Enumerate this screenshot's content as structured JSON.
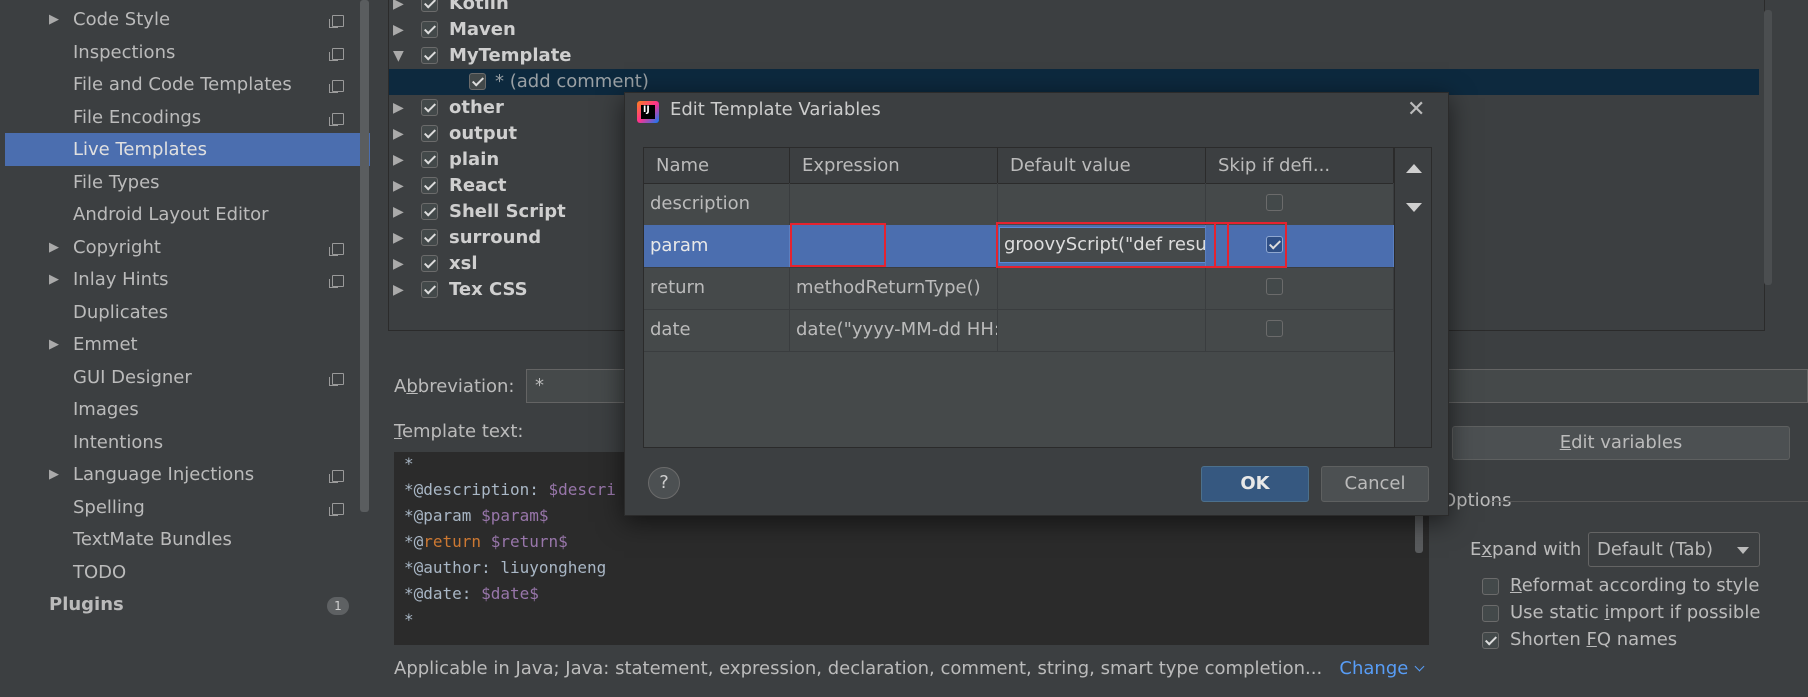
{
  "sidebar": {
    "items": [
      {
        "label": "Code Style",
        "has_arrow": true,
        "has_copy": true
      },
      {
        "label": "Inspections",
        "has_arrow": false,
        "has_copy": true
      },
      {
        "label": "File and Code Templates",
        "has_arrow": false,
        "has_copy": true
      },
      {
        "label": "File Encodings",
        "has_arrow": false,
        "has_copy": true
      },
      {
        "label": "Live Templates",
        "has_arrow": false,
        "has_copy": false,
        "selected": true
      },
      {
        "label": "File Types",
        "has_arrow": false,
        "has_copy": false
      },
      {
        "label": "Android Layout Editor",
        "has_arrow": false,
        "has_copy": false
      },
      {
        "label": "Copyright",
        "has_arrow": true,
        "has_copy": true
      },
      {
        "label": "Inlay Hints",
        "has_arrow": true,
        "has_copy": true
      },
      {
        "label": "Duplicates",
        "has_arrow": false,
        "has_copy": false
      },
      {
        "label": "Emmet",
        "has_arrow": true,
        "has_copy": false
      },
      {
        "label": "GUI Designer",
        "has_arrow": false,
        "has_copy": true
      },
      {
        "label": "Images",
        "has_arrow": false,
        "has_copy": false
      },
      {
        "label": "Intentions",
        "has_arrow": false,
        "has_copy": false
      },
      {
        "label": "Language Injections",
        "has_arrow": true,
        "has_copy": true
      },
      {
        "label": "Spelling",
        "has_arrow": false,
        "has_copy": true
      },
      {
        "label": "TextMate Bundles",
        "has_arrow": false,
        "has_copy": false
      },
      {
        "label": "TODO",
        "has_arrow": false,
        "has_copy": false
      }
    ],
    "plugins_label": "Plugins",
    "plugins_badge": "1"
  },
  "templates_tree": {
    "groups": [
      {
        "label": "Kotlin",
        "expanded": false,
        "checked": true
      },
      {
        "label": "Maven",
        "expanded": false,
        "checked": true
      },
      {
        "label": "MyTemplate",
        "expanded": true,
        "checked": true
      },
      {
        "label": "* (add comment)",
        "child": true,
        "checked": true,
        "selected": true
      },
      {
        "label": "other",
        "expanded": false,
        "checked": true
      },
      {
        "label": "output",
        "expanded": false,
        "checked": true
      },
      {
        "label": "plain",
        "expanded": false,
        "checked": true
      },
      {
        "label": "React",
        "expanded": false,
        "checked": true
      },
      {
        "label": "Shell Script",
        "expanded": false,
        "checked": true
      },
      {
        "label": "surround",
        "expanded": false,
        "checked": true
      },
      {
        "label": "xsl",
        "expanded": false,
        "checked": true
      },
      {
        "label": "Tex CSS",
        "expanded": false,
        "checked": true
      }
    ]
  },
  "abbreviation": {
    "label_pre": "A",
    "label_ul": "b",
    "label_post": "breviation:",
    "value": "*"
  },
  "template_text": {
    "label_ul": "T",
    "label_post": "emplate text:",
    "lines": [
      [
        {
          "t": "*",
          "c": ""
        }
      ],
      [
        {
          "t": " *@description: ",
          "c": ""
        },
        {
          "t": "$descri",
          "c": "var"
        }
      ],
      [
        {
          "t": " *@param ",
          "c": ""
        },
        {
          "t": "$param$",
          "c": "var"
        }
      ],
      [
        {
          "t": " *@",
          "c": ""
        },
        {
          "t": "return",
          "c": "kw"
        },
        {
          "t": " ",
          "c": ""
        },
        {
          "t": "$return$",
          "c": "var"
        }
      ],
      [
        {
          "t": " *@author: liuyongheng",
          "c": ""
        }
      ],
      [
        {
          "t": " *@date: ",
          "c": ""
        },
        {
          "t": "$date$",
          "c": "var"
        }
      ],
      [
        {
          "t": " *",
          "c": ""
        }
      ]
    ]
  },
  "edit_variables_button": {
    "ul": "E",
    "rest": "dit variables"
  },
  "options": {
    "title": "Options",
    "expand_with_pre": "E",
    "expand_with_ul": "x",
    "expand_with_post": "pand with",
    "expand_with_value": "Default (Tab)",
    "checks": [
      {
        "pre": "",
        "ul": "R",
        "post": "eformat according to style",
        "checked": false
      },
      {
        "pre": "Use static ",
        "ul": "i",
        "post": "mport if possible",
        "checked": false
      },
      {
        "pre": "Shorten ",
        "ul": "F",
        "post": "Q names",
        "checked": true
      }
    ]
  },
  "applicable": {
    "text": "Applicable in Java; Java: statement, expression, declaration, comment, string, smart type completion...",
    "change_label": "Change"
  },
  "dialog": {
    "title": "Edit Template Variables",
    "close_glyph": "✕",
    "columns": [
      "Name",
      "Expression",
      "Default value",
      "Skip if defi..."
    ],
    "rows": [
      {
        "name": "description",
        "expression": "",
        "default": "",
        "skip": false
      },
      {
        "name": "param",
        "expression": "",
        "default": "groovyScript(\"def result...",
        "skip": true,
        "selected": true
      },
      {
        "name": "return",
        "expression": "methodReturnType()",
        "default": "",
        "skip": false
      },
      {
        "name": "date",
        "expression": "date(\"yyyy-MM-dd HH:...",
        "default": "",
        "skip": false
      }
    ],
    "help_label": "?",
    "ok_label": "OK",
    "cancel_label": "Cancel"
  },
  "colors": {
    "selection": "#4b6eaf",
    "highlight_box": "#e5232f",
    "link": "#589df6",
    "ok_button": "#365880"
  }
}
